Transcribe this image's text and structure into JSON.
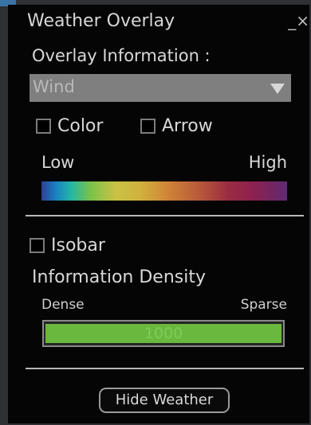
{
  "window": {
    "title": "Weather Overlay",
    "minimize_glyph": "_",
    "close_glyph": "×"
  },
  "overlay": {
    "label": "Overlay Information :",
    "selected": "Wind"
  },
  "options": {
    "color_label": "Color",
    "color_checked": false,
    "arrow_label": "Arrow",
    "arrow_checked": false
  },
  "scale": {
    "low_label": "Low",
    "high_label": "High"
  },
  "isobar": {
    "label": "Isobar",
    "checked": false,
    "density_label": "Information Density",
    "dense_label": "Dense",
    "sparse_label": "Sparse",
    "value": "1000",
    "fill_fraction": 1.0
  },
  "actions": {
    "hide_label": "Hide Weather"
  },
  "colors": {
    "panel_bg": "#050505",
    "slider_fill": "#6ab83e",
    "select_bg": "#7f7f7f",
    "window_edge": "#3a73a6"
  }
}
